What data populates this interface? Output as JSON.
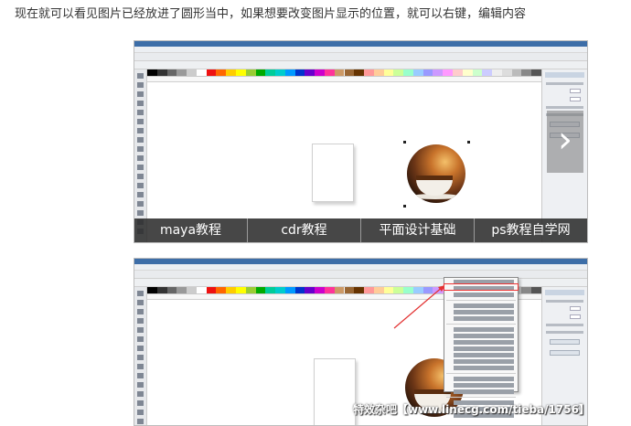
{
  "intro_text": "现在就可以看见图片已经放进了圆形当中，如果想要改变图片显示的位置，就可以右键，编辑内容",
  "carousel": {
    "captions": [
      "maya教程",
      "cdr教程",
      "平面设计基础",
      "ps教程自学网"
    ],
    "next_icon": "chevron-right-icon",
    "next_glyph": "›"
  },
  "colors": {
    "caption_bar": "#2d2d2d",
    "highlight": "#e33333",
    "title_bar": "#3d6ea8"
  },
  "watermark": "特效杂吧【www.linecg.com/tieba/1756】"
}
